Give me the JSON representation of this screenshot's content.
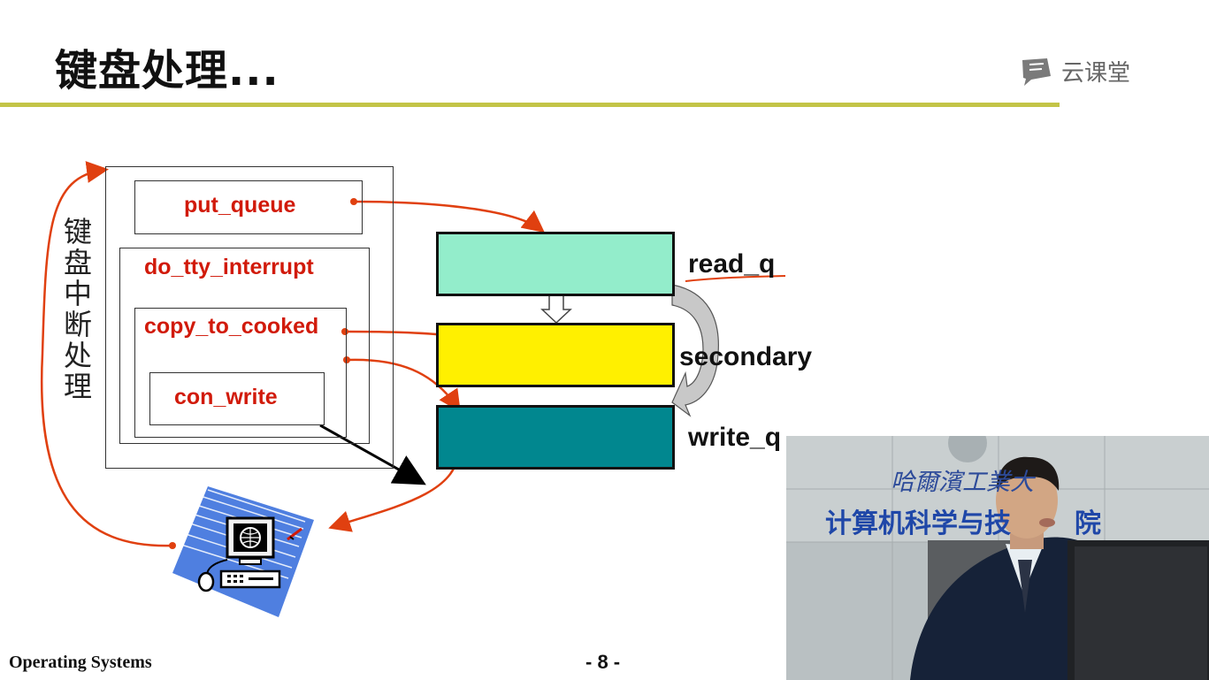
{
  "slide": {
    "title": "键盘处理...",
    "brand": "云课堂",
    "vertical_label": "键盘中断处理",
    "footer_left": "Operating Systems",
    "page_number": "- 8 -"
  },
  "diagram": {
    "functions": [
      "put_queue",
      "do_tty_interrupt",
      "copy_to_cooked",
      "con_write"
    ],
    "queues": [
      {
        "label": "read_q",
        "color": "#93edcb"
      },
      {
        "label": "secondary",
        "color": "#fff000"
      },
      {
        "label": "write_q",
        "color": "#01878f"
      }
    ],
    "arrow_color": "#e04010"
  },
  "video": {
    "wall_text_1": "哈爾濱工業大",
    "wall_text_2": "计算机科学与技",
    "wall_text_3": "院"
  },
  "colors": {
    "title_rule": "#c3c447",
    "function_text": "#d11a0a"
  }
}
